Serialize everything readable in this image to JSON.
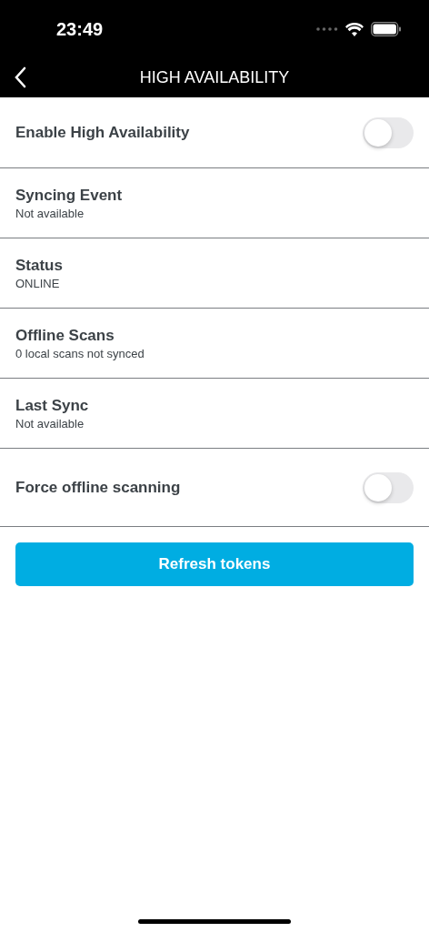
{
  "status_bar": {
    "time": "23:49"
  },
  "nav": {
    "title": "HIGH AVAILABILITY"
  },
  "rows": [
    {
      "kind": "toggle",
      "label": "Enable High Availability",
      "on": false
    },
    {
      "kind": "info",
      "label": "Syncing Event",
      "value": "Not available"
    },
    {
      "kind": "info",
      "label": "Status",
      "value": "ONLINE"
    },
    {
      "kind": "info",
      "label": "Offline Scans",
      "value": "0 local scans not synced"
    },
    {
      "kind": "info",
      "label": "Last Sync",
      "value": "Not available"
    },
    {
      "kind": "toggle",
      "label": "Force offline scanning",
      "on": false
    }
  ],
  "button": {
    "label": "Refresh tokens"
  }
}
